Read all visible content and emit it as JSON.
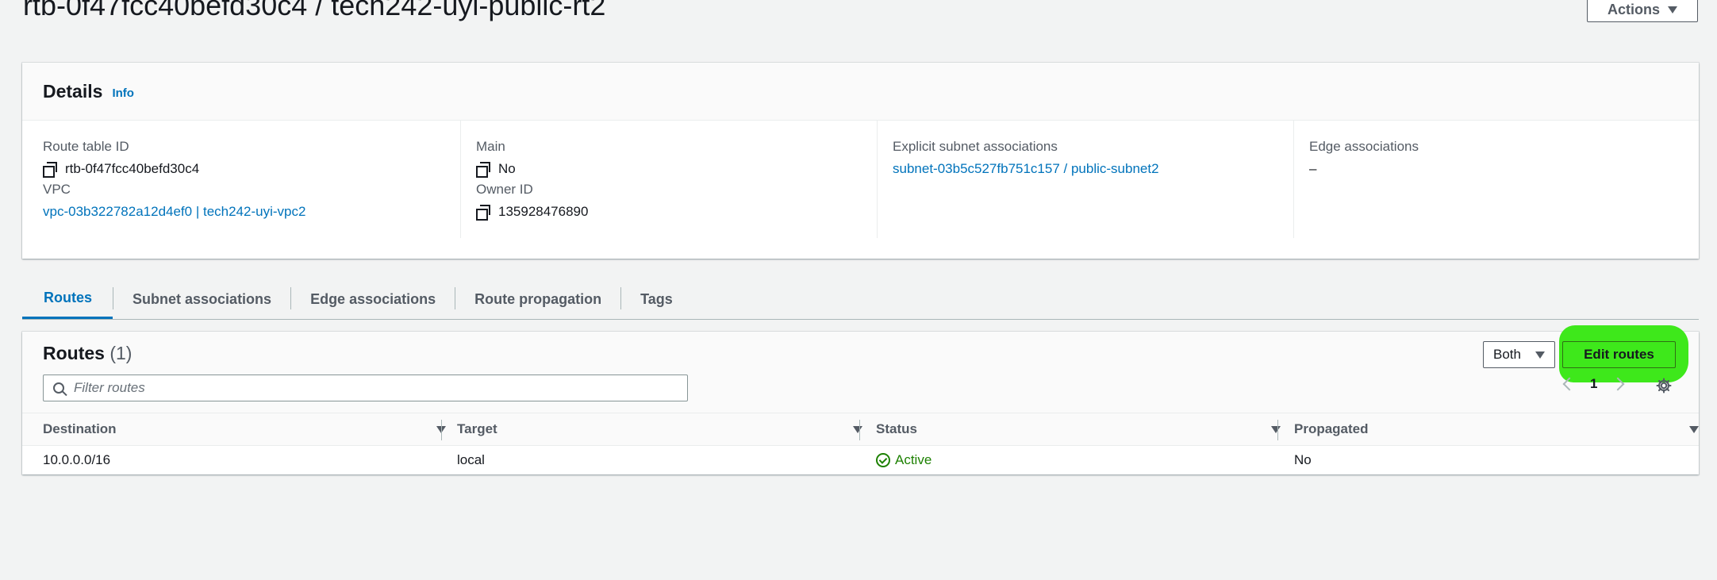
{
  "header": {
    "title": "rtb-0f47fcc40befd30c4 / tech242-uyi-public-rt2",
    "actions_label": "Actions"
  },
  "details": {
    "title": "Details",
    "info_label": "Info",
    "route_table_id_label": "Route table ID",
    "route_table_id": "rtb-0f47fcc40befd30c4",
    "vpc_label": "VPC",
    "vpc": "vpc-03b322782a12d4ef0 | tech242-uyi-vpc2",
    "main_label": "Main",
    "main": "No",
    "owner_label": "Owner ID",
    "owner": "135928476890",
    "explicit_label": "Explicit subnet associations",
    "explicit": "subnet-03b5c527fb751c157 / public-subnet2",
    "edge_label": "Edge associations",
    "edge": "–"
  },
  "tabs": [
    {
      "label": "Routes",
      "active": true
    },
    {
      "label": "Subnet associations",
      "active": false
    },
    {
      "label": "Edge associations",
      "active": false
    },
    {
      "label": "Route propagation",
      "active": false
    },
    {
      "label": "Tags",
      "active": false
    }
  ],
  "routes": {
    "title": "Routes",
    "count": "(1)",
    "filter_placeholder": "Filter routes",
    "select_value": "Both",
    "edit_label": "Edit routes",
    "page": "1",
    "columns": [
      "Destination",
      "Target",
      "Status",
      "Propagated"
    ],
    "rows": [
      {
        "destination": "10.0.0.0/16",
        "target": "local",
        "status": "Active",
        "propagated": "No"
      }
    ]
  },
  "colors": {
    "link": "#0073bb",
    "status_active": "#1d8102",
    "highlight": "#3ee81b"
  }
}
